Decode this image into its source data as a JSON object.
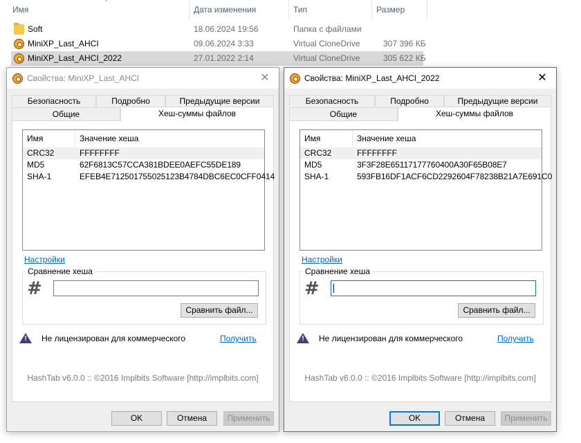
{
  "explorer": {
    "columns": {
      "name": "Имя",
      "date": "Дата изменения",
      "type": "Тип",
      "size": "Размер"
    },
    "rows": [
      {
        "name": "Soft",
        "date": "18.06.2024 19:56",
        "type": "Папка с файлами",
        "size": "",
        "icon": "folder-icon"
      },
      {
        "name": "MiniXP_Last_AHCI",
        "date": "09.06.2024 3:33",
        "type": "Virtual CloneDrive",
        "size": "307 396 КБ",
        "icon": "virtual-clonedrive-icon"
      },
      {
        "name": "MiniXP_Last_AHCI_2022",
        "date": "27.01.2022 2:14",
        "type": "Virtual CloneDrive",
        "size": "305 622 КБ",
        "icon": "virtual-clonedrive-icon"
      }
    ]
  },
  "dialogs": [
    {
      "title": "Свойства: MiniXP_Last_AHCI",
      "active": false,
      "close_glyph": "✕",
      "tabs_top": [
        "Безопасность",
        "Подробно",
        "Предыдущие версии"
      ],
      "tabs_bottom": [
        "Общие",
        "Хеш-суммы файлов"
      ],
      "list_headers": {
        "algo": "Имя",
        "value": "Значение хеша"
      },
      "hashes": [
        {
          "algo": "CRC32",
          "value": "FFFFFFFF"
        },
        {
          "algo": "MD5",
          "value": "62F6813C57CCA381BDEE0AEFC55DE189"
        },
        {
          "algo": "SHA-1",
          "value": "EFEB4E712501755025123B4784DBC6EC0CFF0414"
        }
      ],
      "settings_link": "Настройки",
      "compare_group": "Сравнение хеша",
      "hash_glyph": "#",
      "compare_input_value": "",
      "compare_button": "Сравнить файл...",
      "license_text": "Не лицензирован для коммерческого",
      "get_link": "Получить",
      "warn_mark": "!",
      "footer": "HashTab v6.0.0 :: ©2016 Implbits Software [http://implbits.com]",
      "ok": "OK",
      "cancel": "Отмена",
      "apply": "Применить"
    },
    {
      "title": "Свойства: MiniXP_Last_AHCI_2022",
      "active": true,
      "close_glyph": "✕",
      "tabs_top": [
        "Безопасность",
        "Подробно",
        "Предыдущие версии"
      ],
      "tabs_bottom": [
        "Общие",
        "Хеш-суммы файлов"
      ],
      "list_headers": {
        "algo": "Имя",
        "value": "Значение хеша"
      },
      "hashes": [
        {
          "algo": "CRC32",
          "value": "FFFFFFFF"
        },
        {
          "algo": "MD5",
          "value": "3F3F28E65117177760400A30F65B08E7"
        },
        {
          "algo": "SHA-1",
          "value": "593FB16DF1ACF6CD2292604F78238B21A7E691C0"
        }
      ],
      "settings_link": "Настройки",
      "compare_group": "Сравнение хеша",
      "hash_glyph": "#",
      "compare_input_value": "",
      "compare_button": "Сравнить файл...",
      "license_text": "Не лицензирован для коммерческого",
      "get_link": "Получить",
      "warn_mark": "!",
      "footer": "HashTab v6.0.0 :: ©2016 Implbits Software [http://implbits.com]",
      "ok": "OK",
      "cancel": "Отмена",
      "apply": "Применить"
    }
  ]
}
